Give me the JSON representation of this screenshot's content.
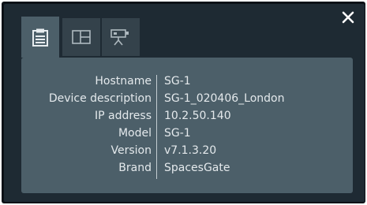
{
  "tabs": [
    {
      "name": "info",
      "icon": "clipboard-icon",
      "active": true
    },
    {
      "name": "layout",
      "icon": "layout-icon",
      "active": false
    },
    {
      "name": "camera",
      "icon": "camera-icon",
      "active": false
    }
  ],
  "close_icon": "close-icon",
  "info": {
    "rows": [
      {
        "label": "Hostname",
        "value": "SG-1"
      },
      {
        "label": "Device description",
        "value": "SG-1_020406_London"
      },
      {
        "label": "IP address",
        "value": "10.2.50.140"
      },
      {
        "label": "Model",
        "value": "SG-1"
      },
      {
        "label": "Version",
        "value": "v7.1.3.20"
      },
      {
        "label": "Brand",
        "value": "SpacesGate"
      }
    ]
  },
  "colors": {
    "background": "#1e2a33",
    "panel": "#4c5f69",
    "tab_inactive": "#34424b",
    "text": "#e4e9ec"
  }
}
